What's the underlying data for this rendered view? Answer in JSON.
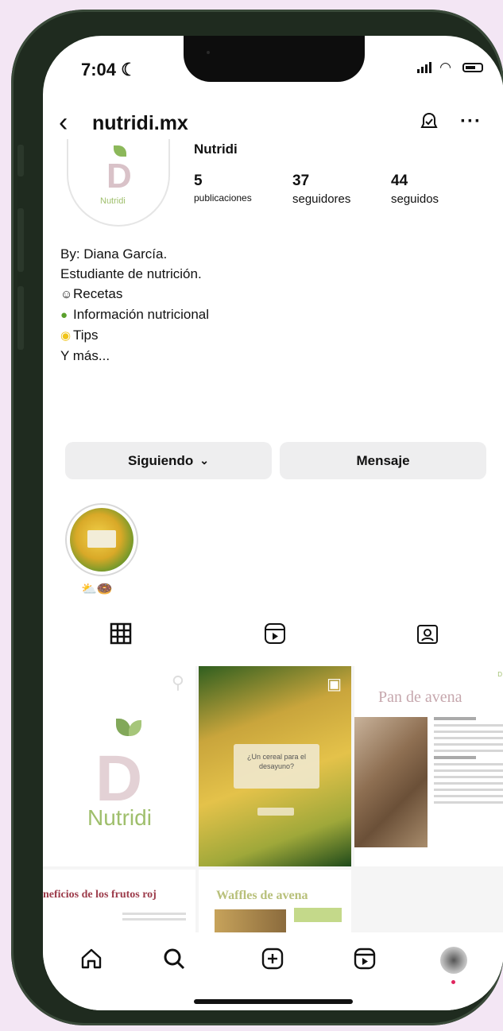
{
  "status_bar": {
    "time": "7:04"
  },
  "header": {
    "username": "nutridi.mx",
    "back_icon": "chevron-left-icon",
    "bell_icon": "bell-icon",
    "more_icon": "ellipsis-icon"
  },
  "profile": {
    "avatar_text": "Nutridi",
    "name": "Nutridi",
    "stats": [
      {
        "value": "5",
        "label": "publicaciones"
      },
      {
        "value": "37",
        "label": "seguidores"
      },
      {
        "value": "44",
        "label": "seguidos"
      }
    ],
    "bio": [
      "By: Diana García.",
      "Estudiante de nutrición.",
      "Recetas",
      "Información nutricional",
      "Tips",
      "Y más..."
    ]
  },
  "actions": {
    "follow_label": "Siguiendo",
    "message_label": "Mensaje"
  },
  "highlights": [
    {
      "label": "⛅🍩"
    }
  ],
  "tabs": [
    {
      "icon": "grid-icon"
    },
    {
      "icon": "reels-icon"
    },
    {
      "icon": "tagged-icon"
    }
  ],
  "posts": {
    "logo_name": "Nutridi",
    "reel_card_text": "¿Un cereal para el desayuno?",
    "pan_title": "Pan de avena",
    "frutos_title": "neficios de los frutos roj",
    "waffle_title": "Waffles de avena"
  },
  "bottom_nav": [
    {
      "icon": "home-icon"
    },
    {
      "icon": "search-icon"
    },
    {
      "icon": "add-post-icon"
    },
    {
      "icon": "reels-icon"
    },
    {
      "icon": "profile-avatar"
    }
  ],
  "colors": {
    "accent_green": "#9fbf6c",
    "button_bg": "#eeeeef",
    "logo_pink": "#e3d1d5"
  }
}
